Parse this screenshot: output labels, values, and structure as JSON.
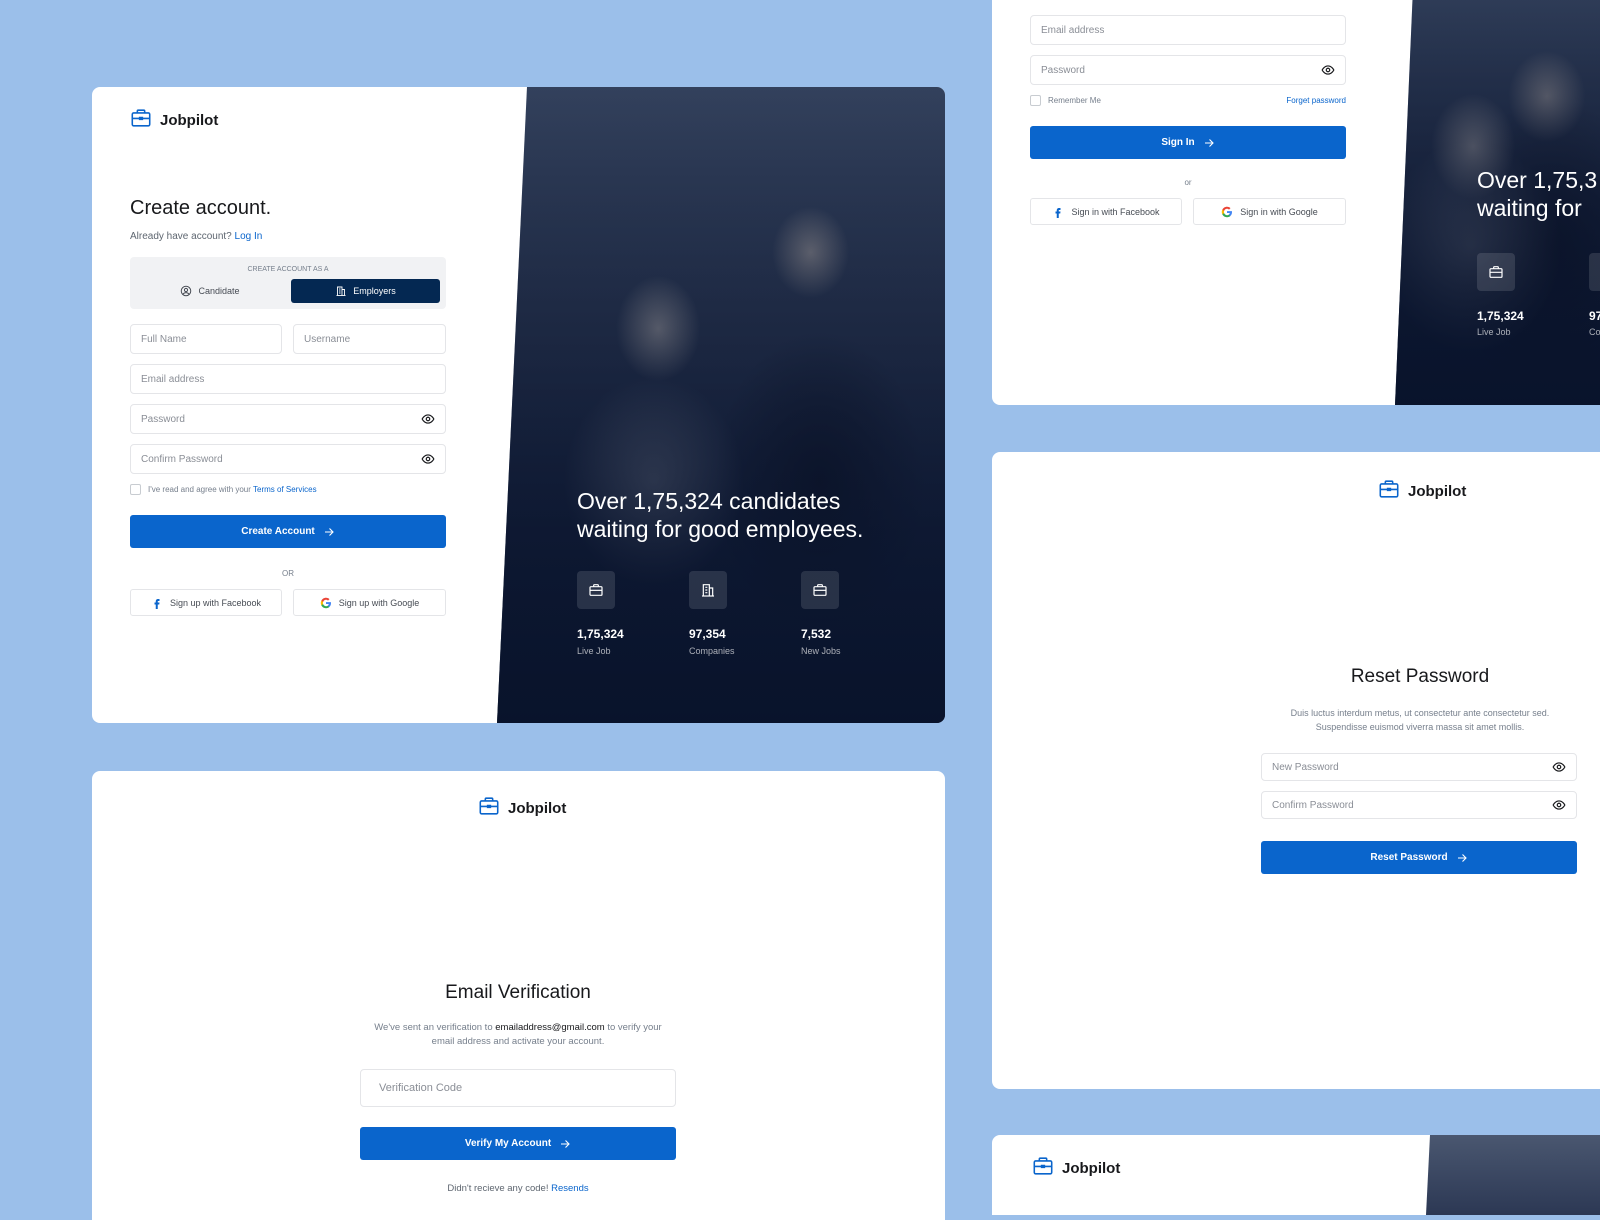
{
  "brand": {
    "name": "Jobpilot"
  },
  "signup": {
    "title": "Create account.",
    "already_text": "Already have account?",
    "login_link": "Log In",
    "account_type_label": "CREATE ACCOUNT AS A",
    "candidate_label": "Candidate",
    "employers_label": "Employers",
    "fullname_placeholder": "Full Name",
    "username_placeholder": "Username",
    "email_placeholder": "Email address",
    "password_placeholder": "Password",
    "confirm_placeholder": "Confirm Password",
    "terms_text": "I've read and agree with your",
    "terms_link": "Terms of Services",
    "create_button": "Create Account",
    "or_text": "OR",
    "facebook_button": "Sign up with Facebook",
    "google_button": "Sign up with Google"
  },
  "hero": {
    "headline_line1": "Over 1,75,324 candidates",
    "headline_line2": "waiting for good employees.",
    "stats": [
      {
        "value": "1,75,324",
        "label": "Live Job"
      },
      {
        "value": "97,354",
        "label": "Companies"
      },
      {
        "value": "7,532",
        "label": "New Jobs"
      }
    ]
  },
  "signin": {
    "email_placeholder": "Email address",
    "password_placeholder": "Password",
    "remember_label": "Remember Me",
    "forget_link": "Forget password",
    "signin_button": "Sign In",
    "or_text": "or",
    "facebook_button": "Sign in with Facebook",
    "google_button": "Sign in with Google"
  },
  "hero_partial": {
    "headline_line1": "Over 1,75,3",
    "headline_line2": "waiting for",
    "stat_value": "1,75,324",
    "stat_label": "Live Job",
    "stat2_value": "97",
    "stat2_label": "Co"
  },
  "reset": {
    "title": "Reset Password",
    "description_line1": "Duis luctus interdum metus, ut consectetur ante consectetur sed.",
    "description_line2": "Suspendisse euismod viverra massa sit amet mollis.",
    "new_password_placeholder": "New Password",
    "confirm_placeholder": "Confirm Password",
    "reset_button": "Reset Password"
  },
  "verify": {
    "title": "Email Verification",
    "desc_prefix": "We've sent an verification to",
    "email": "emailaddress@gmail.com",
    "desc_suffix": "to verify your",
    "desc_line2": "email address and activate your account.",
    "code_placeholder": "Verification Code",
    "verify_button": "Verify My Account",
    "resend_text": "Didn't recieve any code!",
    "resend_link": "Resends"
  },
  "colors": {
    "primary": "#0a65cc",
    "background": "#9bbfea",
    "dark_navy": "#042852"
  }
}
